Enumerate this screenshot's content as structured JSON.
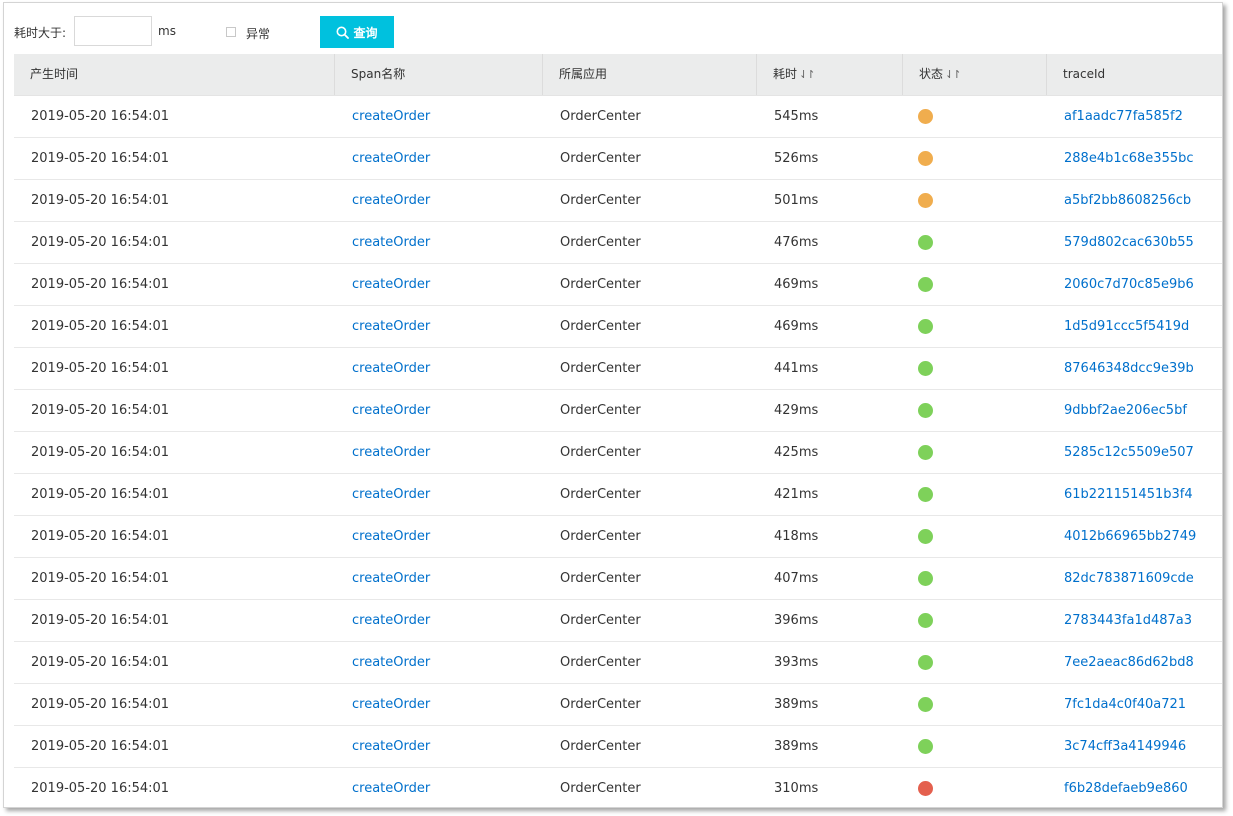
{
  "filter": {
    "duration_label": "耗时大于:",
    "duration_value": "",
    "duration_unit": "ms",
    "error_label": "异常",
    "error_checked": false,
    "query_label": "查询",
    "query_icon": "search-icon"
  },
  "colors": {
    "accent": "#00c1de",
    "link": "#0070cc",
    "status_warning": "#f0ad4e",
    "status_ok": "#7ed15a",
    "status_error": "#e4604e"
  },
  "table": {
    "columns": [
      {
        "label": "产生时间",
        "sortable": false
      },
      {
        "label": "Span名称",
        "sortable": false
      },
      {
        "label": "所属应用",
        "sortable": false
      },
      {
        "label": "耗时",
        "sortable": true
      },
      {
        "label": "状态",
        "sortable": true
      },
      {
        "label": "traceId",
        "sortable": false
      }
    ],
    "sort_icon": "sort-icon",
    "rows": [
      {
        "time": "2019-05-20 16:54:01",
        "span": "createOrder",
        "app": "OrderCenter",
        "duration": "545ms",
        "status": "warning",
        "traceId": "af1aadc77fa585f2"
      },
      {
        "time": "2019-05-20 16:54:01",
        "span": "createOrder",
        "app": "OrderCenter",
        "duration": "526ms",
        "status": "warning",
        "traceId": "288e4b1c68e355bc"
      },
      {
        "time": "2019-05-20 16:54:01",
        "span": "createOrder",
        "app": "OrderCenter",
        "duration": "501ms",
        "status": "warning",
        "traceId": "a5bf2bb8608256cb"
      },
      {
        "time": "2019-05-20 16:54:01",
        "span": "createOrder",
        "app": "OrderCenter",
        "duration": "476ms",
        "status": "ok",
        "traceId": "579d802cac630b55"
      },
      {
        "time": "2019-05-20 16:54:01",
        "span": "createOrder",
        "app": "OrderCenter",
        "duration": "469ms",
        "status": "ok",
        "traceId": "2060c7d70c85e9b6"
      },
      {
        "time": "2019-05-20 16:54:01",
        "span": "createOrder",
        "app": "OrderCenter",
        "duration": "469ms",
        "status": "ok",
        "traceId": "1d5d91ccc5f5419d"
      },
      {
        "time": "2019-05-20 16:54:01",
        "span": "createOrder",
        "app": "OrderCenter",
        "duration": "441ms",
        "status": "ok",
        "traceId": "87646348dcc9e39b"
      },
      {
        "time": "2019-05-20 16:54:01",
        "span": "createOrder",
        "app": "OrderCenter",
        "duration": "429ms",
        "status": "ok",
        "traceId": "9dbbf2ae206ec5bf"
      },
      {
        "time": "2019-05-20 16:54:01",
        "span": "createOrder",
        "app": "OrderCenter",
        "duration": "425ms",
        "status": "ok",
        "traceId": "5285c12c5509e507"
      },
      {
        "time": "2019-05-20 16:54:01",
        "span": "createOrder",
        "app": "OrderCenter",
        "duration": "421ms",
        "status": "ok",
        "traceId": "61b221151451b3f4"
      },
      {
        "time": "2019-05-20 16:54:01",
        "span": "createOrder",
        "app": "OrderCenter",
        "duration": "418ms",
        "status": "ok",
        "traceId": "4012b66965bb2749"
      },
      {
        "time": "2019-05-20 16:54:01",
        "span": "createOrder",
        "app": "OrderCenter",
        "duration": "407ms",
        "status": "ok",
        "traceId": "82dc783871609cde"
      },
      {
        "time": "2019-05-20 16:54:01",
        "span": "createOrder",
        "app": "OrderCenter",
        "duration": "396ms",
        "status": "ok",
        "traceId": "2783443fa1d487a3"
      },
      {
        "time": "2019-05-20 16:54:01",
        "span": "createOrder",
        "app": "OrderCenter",
        "duration": "393ms",
        "status": "ok",
        "traceId": "7ee2aeac86d62bd8"
      },
      {
        "time": "2019-05-20 16:54:01",
        "span": "createOrder",
        "app": "OrderCenter",
        "duration": "389ms",
        "status": "ok",
        "traceId": "7fc1da4c0f40a721"
      },
      {
        "time": "2019-05-20 16:54:01",
        "span": "createOrder",
        "app": "OrderCenter",
        "duration": "389ms",
        "status": "ok",
        "traceId": "3c74cff3a4149946"
      },
      {
        "time": "2019-05-20 16:54:01",
        "span": "createOrder",
        "app": "OrderCenter",
        "duration": "310ms",
        "status": "error",
        "traceId": "f6b28defaeb9e860"
      }
    ]
  }
}
